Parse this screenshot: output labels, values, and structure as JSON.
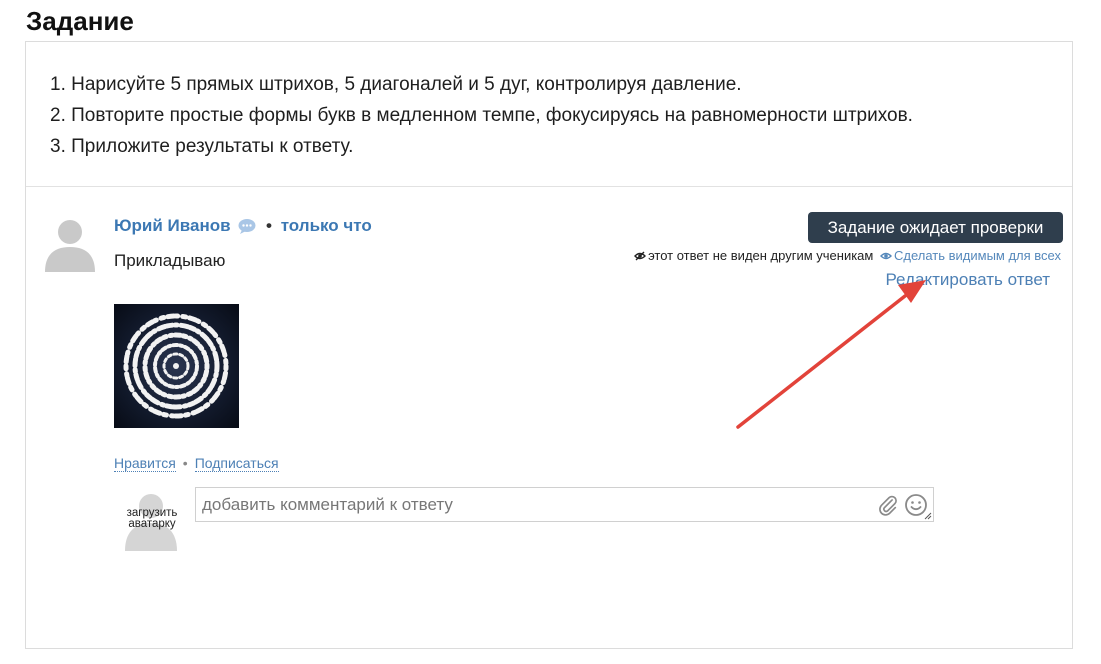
{
  "page": {
    "title": "Задание"
  },
  "task": {
    "items": [
      "1. Нарисуйте 5 прямых штрихов, 5 диагоналей и 5 дуг, контролируя давление.",
      "2. Повторите простые формы букв в медленном темпе, фокусируясь на равномерности штрихов.",
      "3. Приложите результаты к ответу."
    ]
  },
  "answer": {
    "author": "Юрий Иванов",
    "separator": "•",
    "time": "только что",
    "text": "Прикладываю",
    "status_label": "Задание ожидает проверки",
    "visibility_note": "этот ответ не виден другим ученикам",
    "make_visible_label": "Сделать видимым для всех",
    "edit_label": "Редактировать ответ",
    "like_label": "Нравится",
    "subscribe_label": "Подписаться",
    "meta_separator": "•"
  },
  "comment": {
    "upload_avatar_label": "загрузить аватарку",
    "placeholder": "добавить комментарий к ответу"
  },
  "colors": {
    "accent": "#3c78b3",
    "link": "#4d80b5",
    "status_button": "#2f3e4d",
    "annotation_arrow": "#e2433a"
  },
  "icons": {
    "author_badge": "chat-bubble-icon",
    "visibility_hidden": "eye-off-icon",
    "visibility_show": "eye-icon",
    "attach": "paperclip-icon",
    "emoji": "smiley-icon"
  }
}
